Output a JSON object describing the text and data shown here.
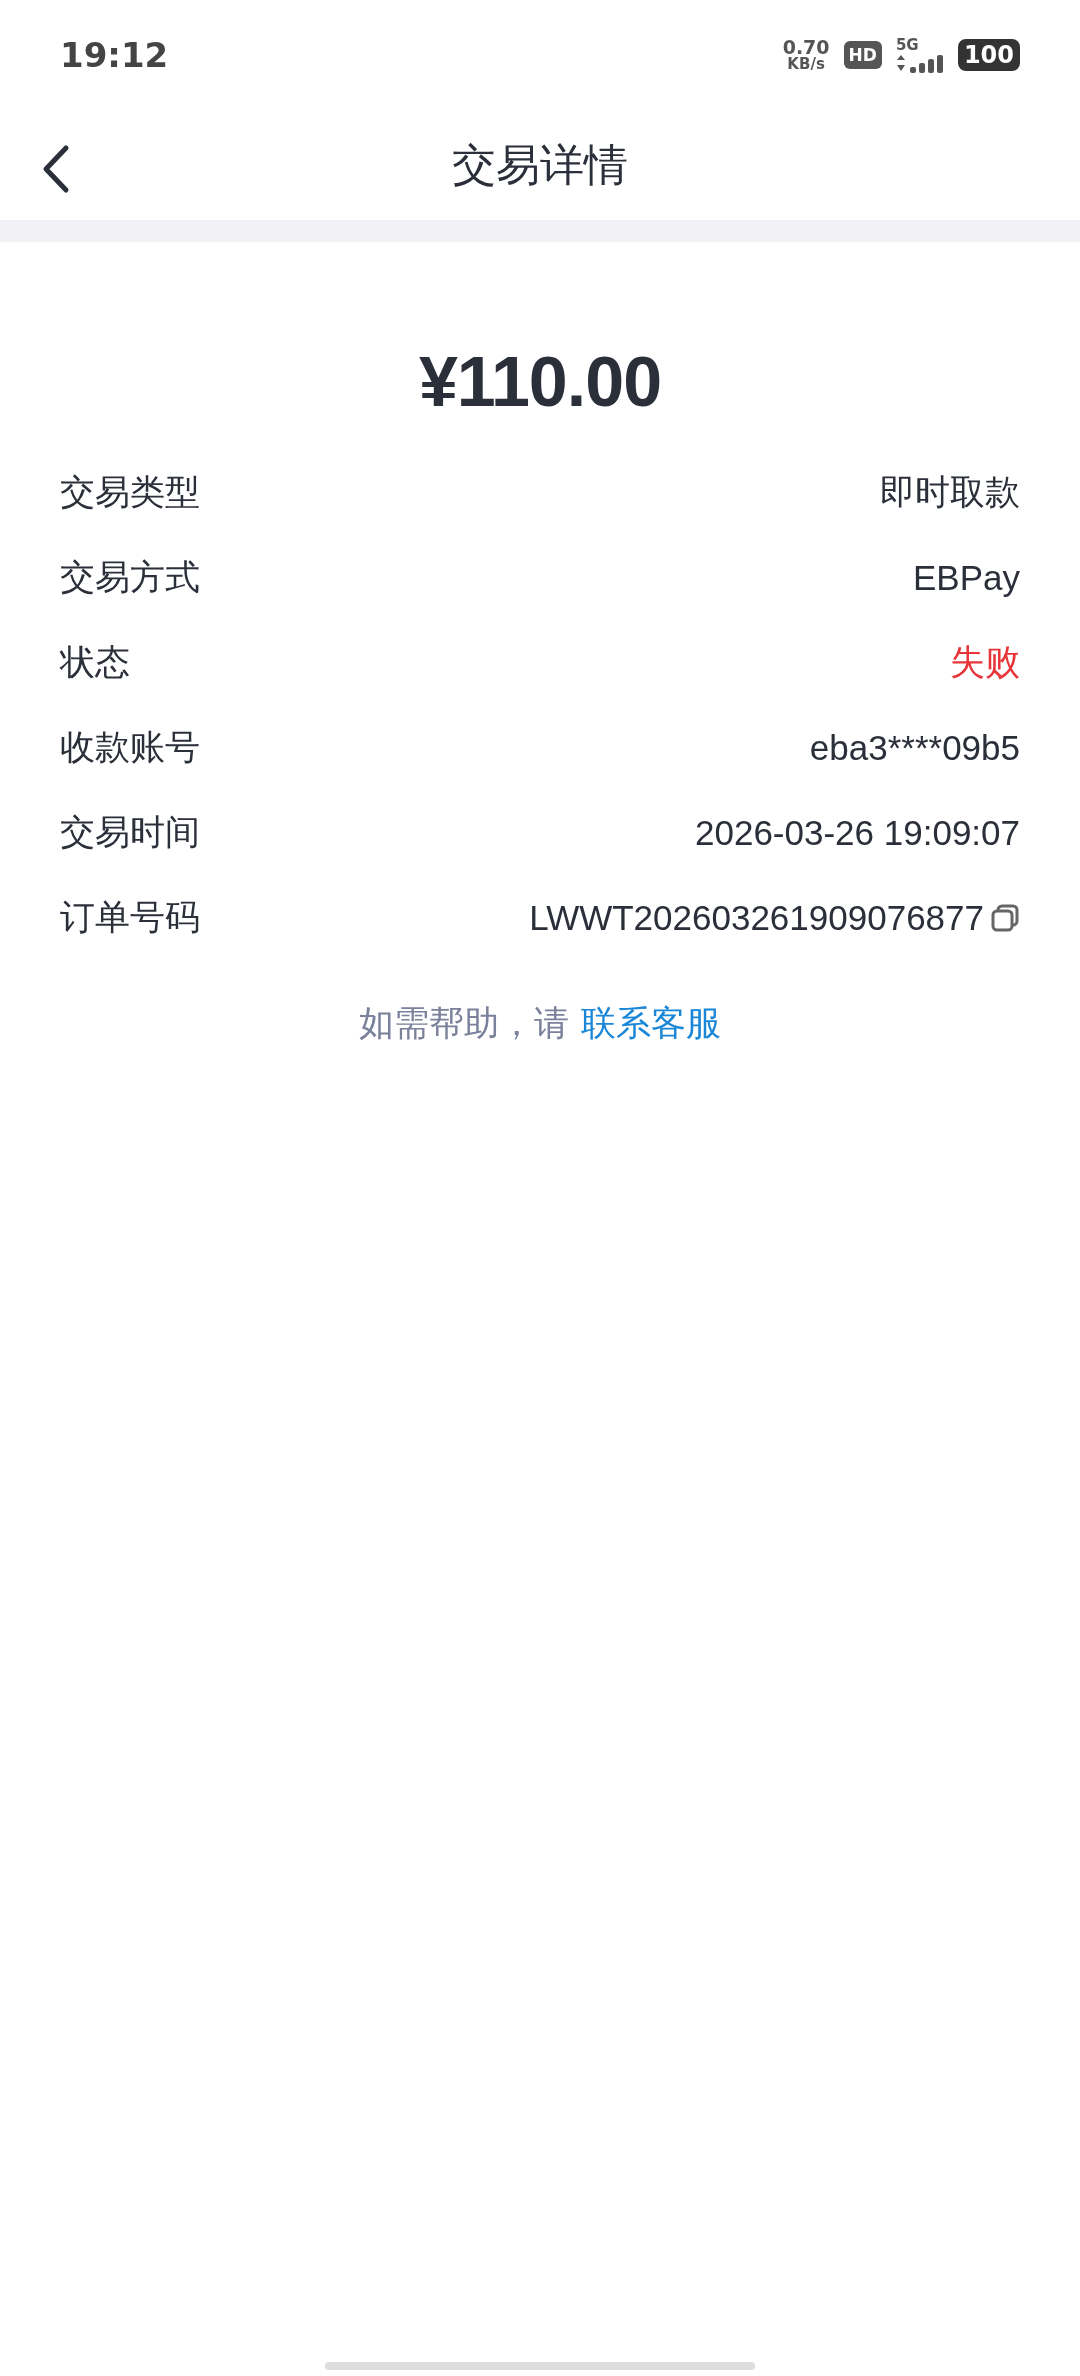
{
  "status_bar": {
    "time": "19:12",
    "speed_value": "0.70",
    "speed_unit": "KB/s",
    "hd_badge": "HD",
    "network": "5G",
    "battery": "100"
  },
  "header": {
    "title": "交易详情"
  },
  "amount": "¥110.00",
  "details": [
    {
      "label": "交易类型",
      "value": "即时取款",
      "color": "#2b2f3a",
      "copyable": false
    },
    {
      "label": "交易方式",
      "value": "EBPay",
      "color": "#2b2f3a",
      "copyable": false
    },
    {
      "label": "状态",
      "value": "失败",
      "color": "#e8353a",
      "copyable": false
    },
    {
      "label": "收款账号",
      "value": "eba3****09b5",
      "color": "#2b2f3a",
      "copyable": false
    },
    {
      "label": "交易时间",
      "value": "2026-03-26 19:09:07",
      "color": "#2b2f3a",
      "copyable": false
    },
    {
      "label": "订单号码",
      "value": "LWWT202603261909076877",
      "color": "#2b2f3a",
      "copyable": true
    }
  ],
  "help": {
    "text": "如需帮助，请",
    "link": "联系客服"
  }
}
